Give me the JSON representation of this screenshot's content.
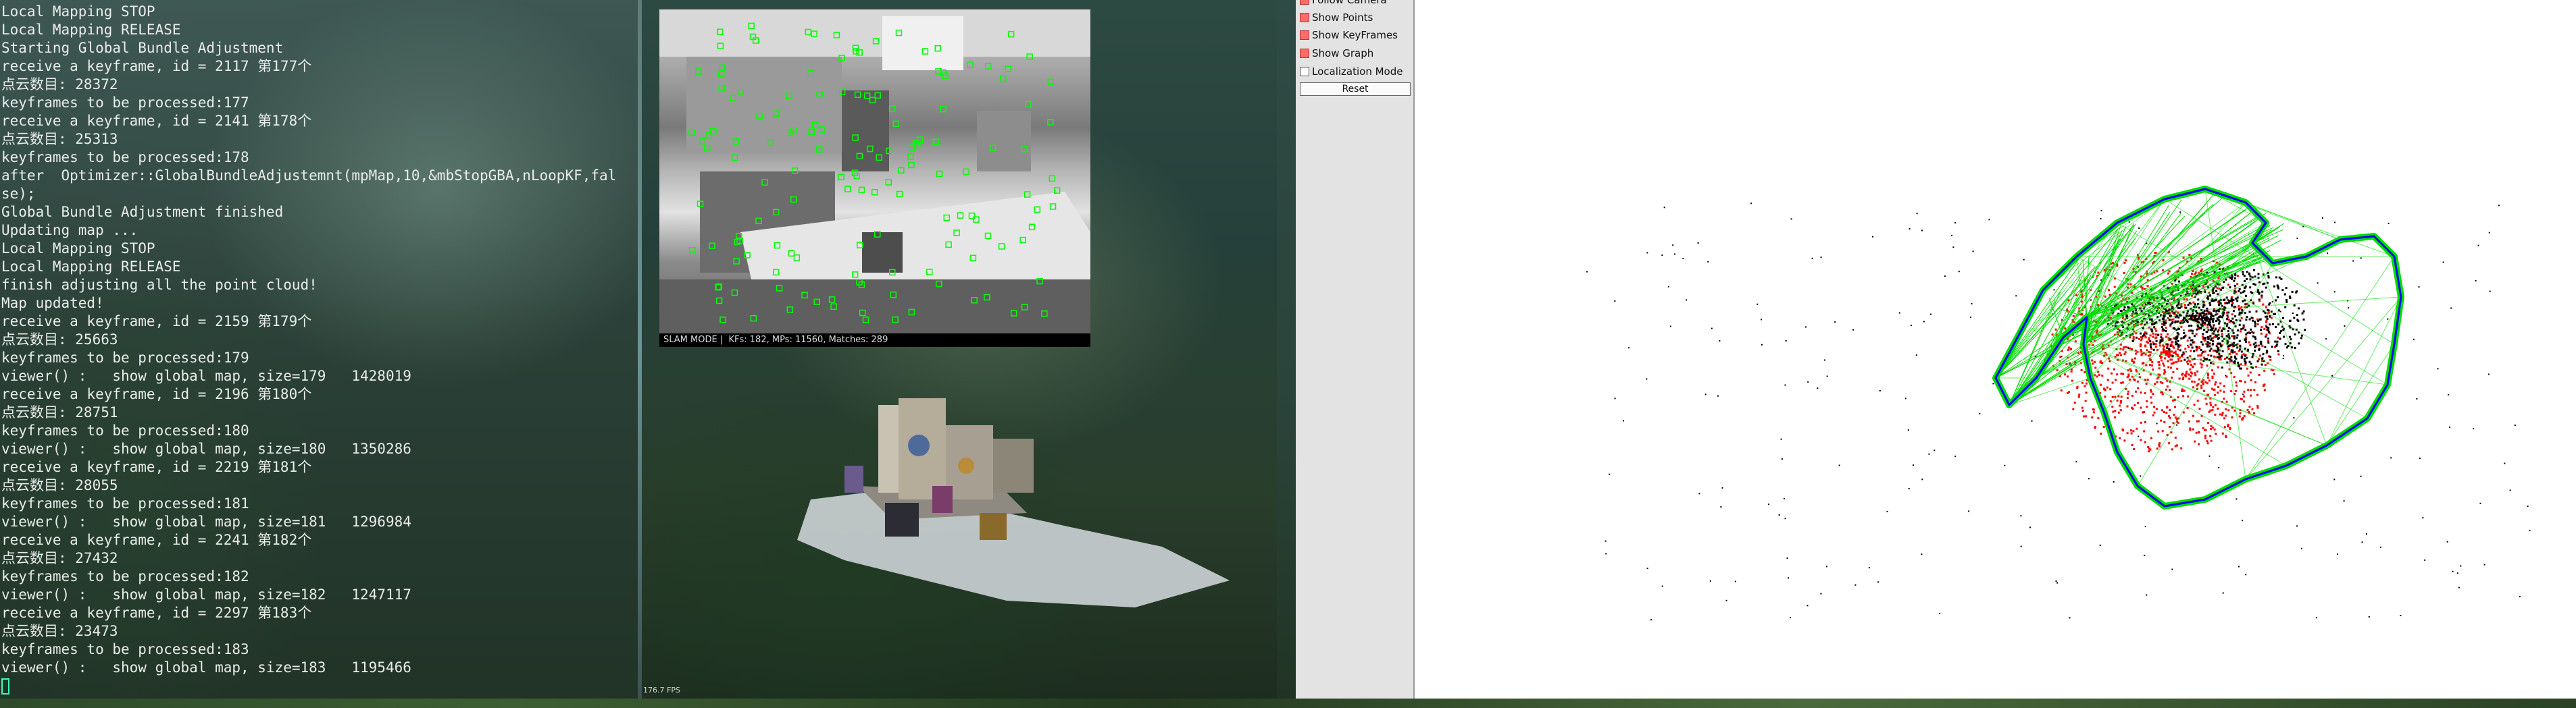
{
  "terminal": {
    "lines": [
      "Local Mapping STOP",
      "Local Mapping RELEASE",
      "Starting Global Bundle Adjustment",
      "receive a keyframe, id = 2117 第177个",
      "点云数目: 28372",
      "keyframes to be processed:177",
      "receive a keyframe, id = 2141 第178个",
      "点云数目: 25313",
      "keyframes to be processed:178",
      "after  Optimizer::GlobalBundleAdjustemnt(mpMap,10,&mbStopGBA,nLoopKF,fal",
      "se);",
      "Global Bundle Adjustment finished",
      "Updating map ...",
      "Local Mapping STOP",
      "Local Mapping RELEASE",
      "finish adjusting all the point cloud!",
      "Map updated!",
      "receive a keyframe, id = 2159 第179个",
      "点云数目: 25663",
      "keyframes to be processed:179",
      "viewer() :   show global map, size=179   1428019",
      "receive a keyframe, id = 2196 第180个",
      "点云数目: 28751",
      "keyframes to be processed:180",
      "viewer() :   show global map, size=180   1350286",
      "receive a keyframe, id = 2219 第181个",
      "点云数目: 28055",
      "keyframes to be processed:181",
      "viewer() :   show global map, size=181   1296984",
      "receive a keyframe, id = 2241 第182个",
      "点云数目: 27432",
      "keyframes to be processed:182",
      "viewer() :   show global map, size=182   1247117",
      "receive a keyframe, id = 2297 第183个",
      "点云数目: 23473",
      "keyframes to be processed:183",
      "viewer() :   show global map, size=183   1195466"
    ]
  },
  "slam_frame": {
    "status_text": "SLAM MODE |  KFs: 182, MPs: 11560, Matches: 289"
  },
  "cloud_view": {
    "fps_text": "176.7 FPS"
  },
  "viewer_controls": {
    "follow_camera": {
      "label": "Follow Camera",
      "checked": true
    },
    "show_points": {
      "label": "Show Points",
      "checked": true
    },
    "show_keyframes": {
      "label": "Show KeyFrames",
      "checked": true
    },
    "show_graph": {
      "label": "Show Graph",
      "checked": true
    },
    "localization_mode": {
      "label": "Localization Mode",
      "checked": false
    },
    "reset_label": "Reset"
  },
  "colors": {
    "terminal_text": "#e9ecea",
    "cursor": "#3cffb4",
    "feature_marker": "#00ff00",
    "map_points_current": "#ff0000",
    "map_points_global": "#000000",
    "keyframe_frustum": "#0000ff",
    "covisibility_graph": "#00dd00"
  }
}
